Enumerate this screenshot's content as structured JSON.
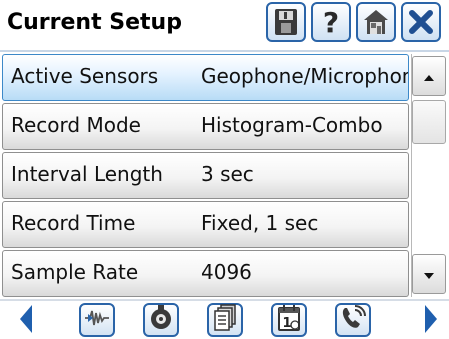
{
  "header": {
    "title": "Current Setup"
  },
  "settings": [
    {
      "label": "Active Sensors",
      "value": "Geophone/Microphone",
      "selected": true
    },
    {
      "label": "Record Mode",
      "value": "Histogram-Combo",
      "selected": false
    },
    {
      "label": "Interval Length",
      "value": "3 sec",
      "selected": false
    },
    {
      "label": "Record Time",
      "value": "Fixed, 1 sec",
      "selected": false
    },
    {
      "label": "Sample Rate",
      "value": "4096",
      "selected": false
    }
  ],
  "header_buttons": [
    "save-icon",
    "help-icon",
    "home-icon",
    "close-icon"
  ],
  "toolbar_buttons": [
    "waveform-icon",
    "sensor-icon",
    "documents-icon",
    "calendar-icon",
    "phone-icon"
  ],
  "colors": {
    "accent": "#2a64a8",
    "selected_row": "#b8dcf6",
    "arrow": "#1f5fae"
  }
}
